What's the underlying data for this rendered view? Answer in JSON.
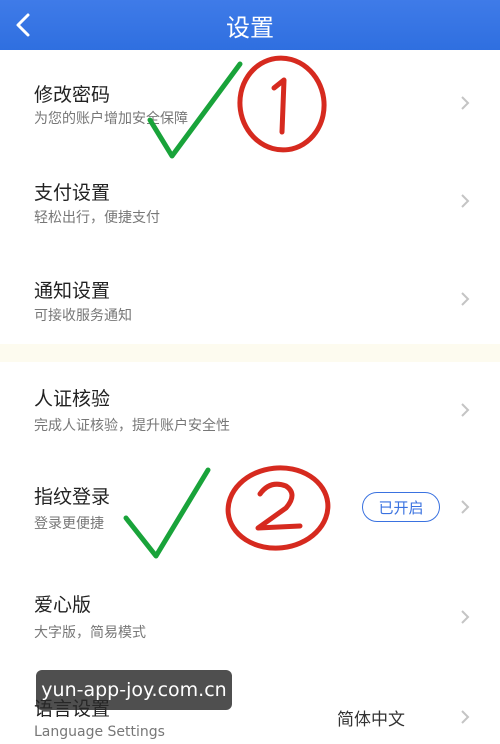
{
  "header": {
    "title": "设置"
  },
  "items": [
    {
      "title": "修改密码",
      "subtitle": "为您的账户增加安全保障"
    },
    {
      "title": "支付设置",
      "subtitle": "轻松出行，便捷支付"
    },
    {
      "title": "通知设置",
      "subtitle": "可接收服务通知"
    },
    {
      "title": "人证核验",
      "subtitle": "完成人证核验，提升账户安全性"
    },
    {
      "title": "指纹登录",
      "subtitle": "登录更便捷",
      "badge": "已开启"
    },
    {
      "title": "爱心版",
      "subtitle": "大字版，简易模式"
    },
    {
      "title": "语言设置",
      "subtitle": "Language Settings",
      "value": "简体中文"
    }
  ],
  "watermark": "yun-app-joy.com.cn",
  "colors": {
    "header": "#2f6fe0",
    "annotation_red": "#d62a1f",
    "annotation_green": "#19a33a"
  },
  "icons": {
    "back": "chevron-left-icon",
    "row_arrow": "chevron-right-icon"
  }
}
